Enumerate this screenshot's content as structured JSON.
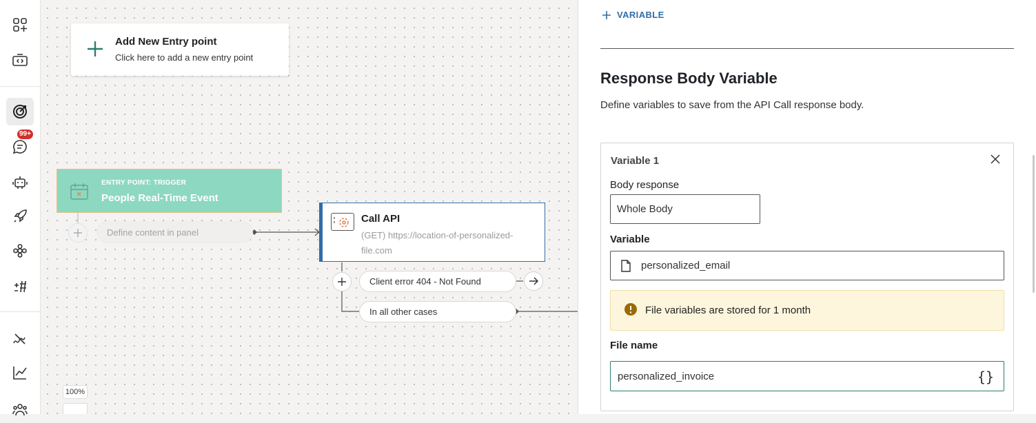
{
  "rail": {
    "badge": "99+",
    "icons": [
      "apps-add-icon",
      "code-window-icon",
      "target-icon",
      "chat-icon",
      "robot-icon",
      "rocket-icon",
      "ai-flower-icon",
      "hashtag-icon",
      "flow-icon",
      "chart-icon",
      "people-icon"
    ]
  },
  "canvas": {
    "entry_card": {
      "title": "Add New Entry point",
      "subtitle": "Click here to add a new entry point"
    },
    "trigger": {
      "kicker": "ENTRY POINT: TRIGGER",
      "name": "People Real-Time Event"
    },
    "define_pill": "Define content in panel",
    "call_api": {
      "title": "Call API",
      "url": "(GET) https://location-of-personalized-file.com"
    },
    "branches": [
      "Client error 404 - Not Found",
      "In all other cases"
    ],
    "zoom": "100%"
  },
  "panel": {
    "add_variable": "VARIABLE",
    "heading": "Response Body Variable",
    "description": "Define variables to save from the API Call response body.",
    "variable": {
      "title": "Variable 1",
      "body_response_label": "Body response",
      "body_response_value": "Whole Body",
      "variable_label": "Variable",
      "variable_value": "personalized_email",
      "warning": "File variables are stored for 1 month",
      "file_name_label": "File name",
      "file_name_value": "personalized_invoice",
      "insert_symbol": "{}"
    }
  },
  "colors": {
    "accent": "#2f6da8",
    "trigger": "#8dd8c0",
    "warning_bg": "#fdf6dd",
    "focus": "#2a7d6d",
    "badge": "#d0312d"
  }
}
